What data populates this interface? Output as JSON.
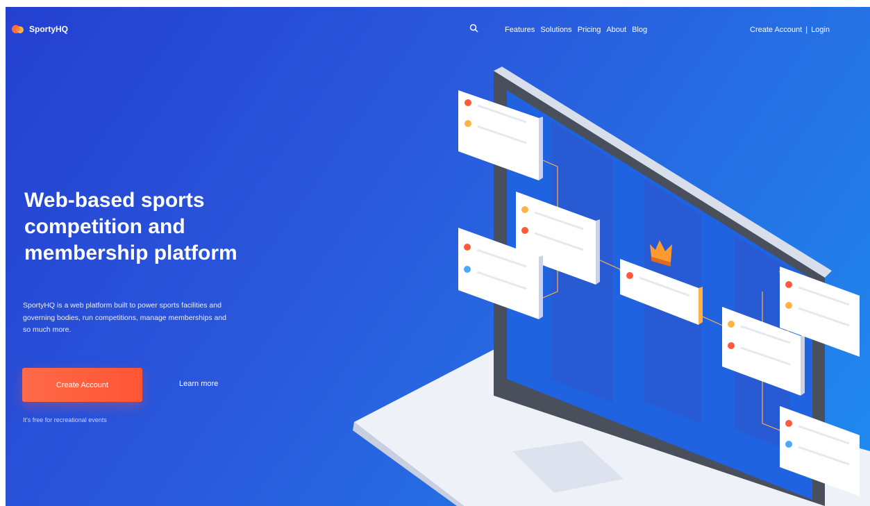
{
  "brand": {
    "name": "SportyHQ",
    "logo_colors": [
      "#ff6a3d",
      "#ffb347"
    ]
  },
  "nav": {
    "search_icon": "search-icon",
    "items": [
      "Features",
      "Solutions",
      "Pricing",
      "About",
      "Blog"
    ],
    "create_account": "Create Account",
    "separator": "|",
    "login": "Login"
  },
  "hero": {
    "title_line1": "Web-based sports",
    "title_line2": "competition and",
    "title_line3": "membership platform",
    "desc_line1": "SportyHQ is a web platform built to power sports facilities and",
    "desc_line2": "governing bodies, run competitions, manage memberships and",
    "desc_line3": "so much more.",
    "cta_primary": "Create Account",
    "cta_secondary": "Learn more",
    "fine_print": "It's free for recreational events"
  },
  "colors": {
    "background": "#2a5ad9",
    "accent": "#ff5a3c",
    "card": "#ffffff",
    "crown": "#ff9b2e"
  }
}
